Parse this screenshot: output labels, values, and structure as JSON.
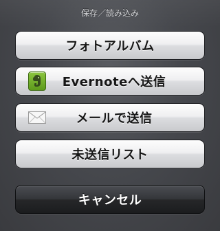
{
  "sheet": {
    "title": "保存／読み込み"
  },
  "buttons": {
    "photo_album": "フォトアルバム",
    "evernote": "Evernoteへ送信",
    "mail": "メールで送信",
    "unsent_list": "未送信リスト",
    "cancel": "キャンセル"
  },
  "icons": {
    "evernote": "evernote-elephant-icon",
    "mail": "envelope-icon"
  },
  "colors": {
    "evernote_green": "#6fae2a",
    "sheet_background": "#46484d"
  }
}
